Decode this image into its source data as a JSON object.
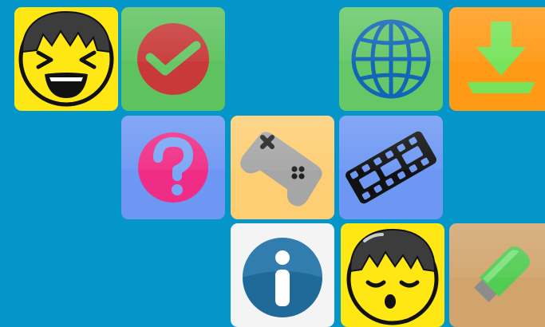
{
  "tiles": [
    {
      "id": "laugh",
      "icon": "laughing-face-icon",
      "color": "#ffe713"
    },
    {
      "id": "clock",
      "icon": "clock-icon",
      "color": "#5ec25e"
    },
    {
      "id": "globe",
      "icon": "globe-icon",
      "color": "#66c766"
    },
    {
      "id": "download",
      "icon": "download-icon",
      "color": "#ff9a16"
    },
    {
      "id": "help",
      "icon": "question-icon",
      "color": "#6d97f3"
    },
    {
      "id": "games",
      "icon": "gamepad-icon",
      "color": "#fdce73"
    },
    {
      "id": "video",
      "icon": "film-strip-icon",
      "color": "#6d97f3"
    },
    {
      "id": "info",
      "icon": "info-icon",
      "color": "#f4f4f4"
    },
    {
      "id": "sleep",
      "icon": "sleeping-face-icon",
      "color": "#ffe713"
    },
    {
      "id": "usb",
      "icon": "usb-drive-icon",
      "color": "#d1a46e"
    }
  ]
}
